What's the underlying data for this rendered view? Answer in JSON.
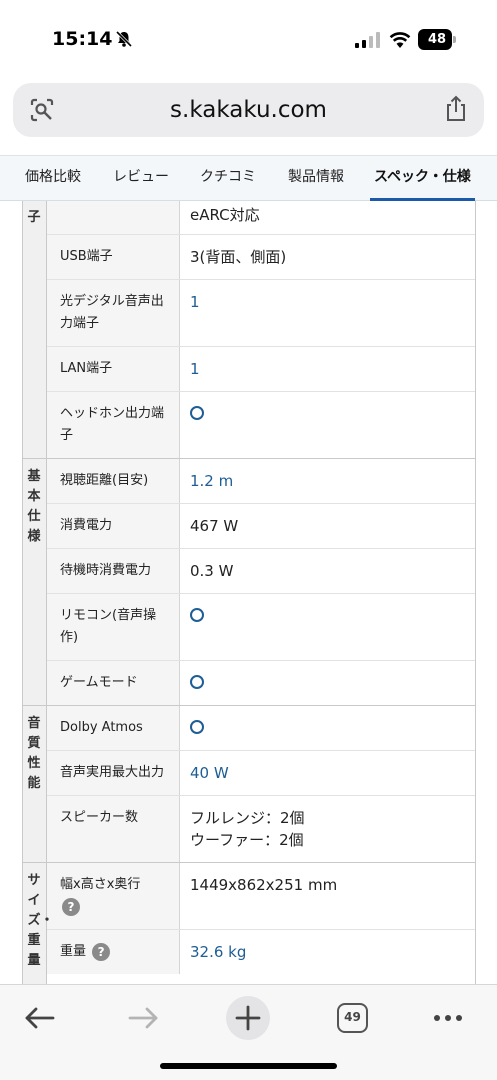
{
  "status_bar": {
    "time": "15:14",
    "battery": "48",
    "icons": [
      "bell-slash-icon",
      "signal-icon",
      "wifi-icon",
      "battery-icon"
    ]
  },
  "browser": {
    "url": "s.kakaku.com",
    "icons": [
      "lens-icon",
      "share-icon"
    ]
  },
  "tabs": [
    {
      "label": "価格比較"
    },
    {
      "label": "レビュー"
    },
    {
      "label": "クチコミ"
    },
    {
      "label": "製品情報"
    },
    {
      "label": "スペック・仕様"
    }
  ],
  "spec_groups": [
    {
      "label": "子",
      "rows": [
        {
          "name": "",
          "value": "eARC対応"
        },
        {
          "name": "USB端子",
          "value": "3(背面、側面)"
        },
        {
          "name": "光デジタル音声出力端子",
          "value": "1"
        },
        {
          "name": "LAN端子",
          "value": "1"
        },
        {
          "name": "ヘッドホン出力端子",
          "value": "○"
        }
      ]
    },
    {
      "label": "基本仕様",
      "rows": [
        {
          "name": "視聴距離(目安)",
          "value": "1.2 m"
        },
        {
          "name": "消費電力",
          "value": "467 W"
        },
        {
          "name": "待機時消費電力",
          "value": "0.3 W"
        },
        {
          "name": "リモコン(音声操作)",
          "value": "○"
        },
        {
          "name": "ゲームモード",
          "value": "○"
        }
      ]
    },
    {
      "label": "音質性能",
      "rows": [
        {
          "name": "Dolby Atmos",
          "value": "○"
        },
        {
          "name": "音声実用最大出力",
          "value": "40 W"
        },
        {
          "name": "スピーカー数",
          "value": "フルレンジ：2個",
          "value2": "ウーファー：2個"
        }
      ]
    },
    {
      "label": "サイズ・重量",
      "rows": [
        {
          "name": "幅x高さx奥行",
          "value": "1449x862x251 mm",
          "help": "?"
        },
        {
          "name": "重量",
          "value": "32.6 kg",
          "help": "?"
        }
      ]
    }
  ],
  "toolbar": {
    "tab_count": "49",
    "icons": [
      "back-arrow-icon",
      "forward-arrow-icon",
      "plus-icon",
      "tabs-icon",
      "more-icon"
    ]
  },
  "colors": {
    "accent": "#1b5aa8",
    "link": "#1e5d95",
    "tab_bg": "#f4f7fa"
  }
}
